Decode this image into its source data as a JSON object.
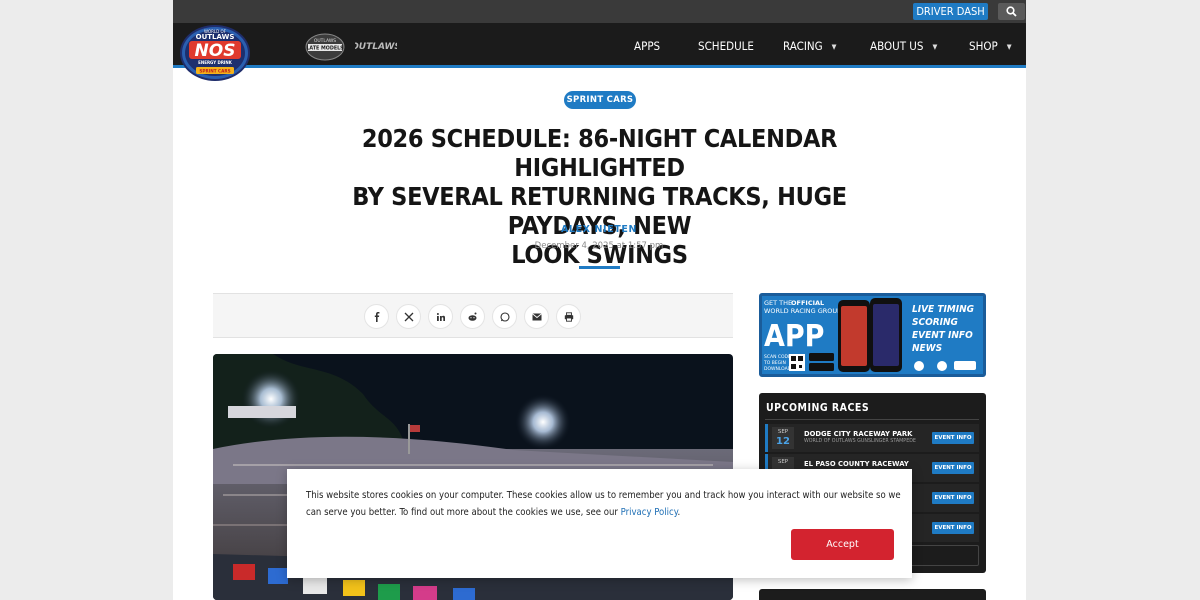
{
  "topbar": {
    "driver_dash_label": "DRIVER DASH"
  },
  "nav": {
    "items": [
      {
        "label": "APPS",
        "has_dropdown": false
      },
      {
        "label": "SCHEDULE",
        "has_dropdown": false
      },
      {
        "label": "RACING",
        "has_dropdown": true
      },
      {
        "label": "ABOUT US",
        "has_dropdown": true
      },
      {
        "label": "SHOP",
        "has_dropdown": true
      }
    ],
    "logo_text": {
      "main_top": "WORLD OF",
      "main_outlaws": "OUTLAWS",
      "main_nos": "NOS",
      "main_sub": "ENERGY DRINK",
      "main_series": "SPRINT CARS",
      "late_models_top": "OUTLAWS",
      "late_models": "LATE MODELS",
      "outlaws_small": "OUTLAWS"
    }
  },
  "article": {
    "category": "SPRINT CARS",
    "headline_lines": [
      "2026 SCHEDULE: 86-NIGHT CALENDAR HIGHLIGHTED",
      "BY SEVERAL RETURNING TRACKS, HUGE PAYDAYS, NEW",
      "LOOK SWINGS"
    ],
    "author": "ALEX NIETEN",
    "date": "December 4, 2025 at 1:57 pm"
  },
  "share": {
    "buttons": [
      "facebook-icon",
      "x-icon",
      "linkedin-icon",
      "reddit-icon",
      "whatsapp-icon",
      "email-icon",
      "print-icon"
    ]
  },
  "app_ad": {
    "get_the": "GET THE",
    "official": "OFFICIAL",
    "group": "WORLD RACING GROUP",
    "app": "APP",
    "scan_lines": [
      "SCAN CODE",
      "TO BEGIN",
      "DOWNLOAD"
    ],
    "features": [
      "LIVE TIMING",
      "SCORING",
      "EVENT INFO",
      "NEWS"
    ]
  },
  "upcoming": {
    "title": "UPCOMING RACES",
    "races": [
      {
        "month": "SEP",
        "day": "12",
        "name": "DODGE CITY RACEWAY PARK",
        "series": "WORLD OF OUTLAWS GUNSLINGER STAMPEDE",
        "button": "EVENT INFO"
      },
      {
        "month": "SEP",
        "day": "",
        "name": "EL PASO COUNTY RACEWAY",
        "series": "",
        "button": "EVENT INFO"
      },
      {
        "month": "",
        "day": "",
        "name": "",
        "series": "",
        "button": "EVENT INFO"
      },
      {
        "month": "",
        "day": "",
        "name": "",
        "series": "",
        "button": "EVENT INFO"
      }
    ]
  },
  "cookie": {
    "text": "This website stores cookies on your computer. These cookies allow us to remember you and track how you interact with our website so we can serve you better. To find out more about the cookies we use, see our ",
    "link": "Privacy Policy",
    "end": ".",
    "accept": "Accept"
  },
  "colors": {
    "brand_blue": "#1f7bc4",
    "nav_bg": "#1b1b1b",
    "accept_red": "#d3232f"
  }
}
